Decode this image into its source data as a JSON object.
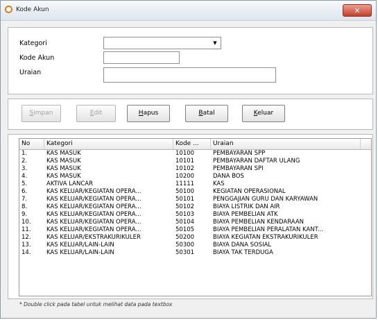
{
  "window": {
    "title": "Kode Akun",
    "close_symbol": "✕"
  },
  "form": {
    "kategori_label": "Kategori",
    "kode_akun_label": "Kode Akun",
    "uraian_label": "Uraian",
    "kategori_value": "",
    "kode_akun_value": "",
    "uraian_value": ""
  },
  "buttons": {
    "simpan": {
      "first": "S",
      "rest": "impan"
    },
    "edit": {
      "first": "E",
      "rest": "dit"
    },
    "hapus": {
      "first": "H",
      "rest": "apus"
    },
    "batal": {
      "first": "B",
      "rest": "atal"
    },
    "keluar": {
      "first": "K",
      "rest": "eluar"
    }
  },
  "table": {
    "columns": [
      "No",
      "Kategori",
      "Kode ...",
      "Uraian"
    ],
    "rows": [
      [
        "1.",
        "KAS MASUK",
        "10100",
        "PEMBAYARAN SPP"
      ],
      [
        "2.",
        "KAS MASUK",
        "10101",
        "PEMBAYARAN DAFTAR ULANG"
      ],
      [
        "3.",
        "KAS MASUK",
        "10102",
        "PEMBAYARAN SPI"
      ],
      [
        "4.",
        "KAS MASUK",
        "10200",
        "DANA BOS"
      ],
      [
        "5.",
        "AKTIVA LANCAR",
        "11111",
        "KAS"
      ],
      [
        "6.",
        "KAS KELUAR/KEGIATAN OPERA...",
        "50100",
        "KEGIATAN OPERASIONAL"
      ],
      [
        "7.",
        "KAS KELUAR/KEGIATAN OPERA...",
        "50101",
        "PENGGAJIAN GURU DAN KARYAWAN"
      ],
      [
        "8.",
        "KAS KELUAR/KEGIATAN OPERA...",
        "50102",
        "BIAYA LISTRIK DAN AIR"
      ],
      [
        "9.",
        "KAS KELUAR/KEGIATAN OPERA...",
        "50103",
        "BIAYA PEMBELIAN ATK"
      ],
      [
        "10.",
        "KAS KELUAR/KEGIATAN OPERA...",
        "50104",
        "BIAYA PEMBELIAN KENDARAAN"
      ],
      [
        "11.",
        "KAS KELUAR/KEGIATAN OPERA...",
        "50105",
        "BIAYA PEMBELIAN PERALATAN KANT..."
      ],
      [
        "12.",
        "KAS KELUAR/EKSTRAKURIKULER",
        "50200",
        "BIAYA KEGIATAN EKSTRAKURIKULER"
      ],
      [
        "13.",
        "KAS KELUAR/LAIN-LAIN",
        "50300",
        "BIAYA DANA SOSIAL"
      ],
      [
        "14.",
        "KAS KELUAR/LAIN-LAIN",
        "50301",
        "BIAYA TAK TERDUGA"
      ]
    ]
  },
  "footer_note": "* Double click pada tabel untuk melihat data pada textbox"
}
